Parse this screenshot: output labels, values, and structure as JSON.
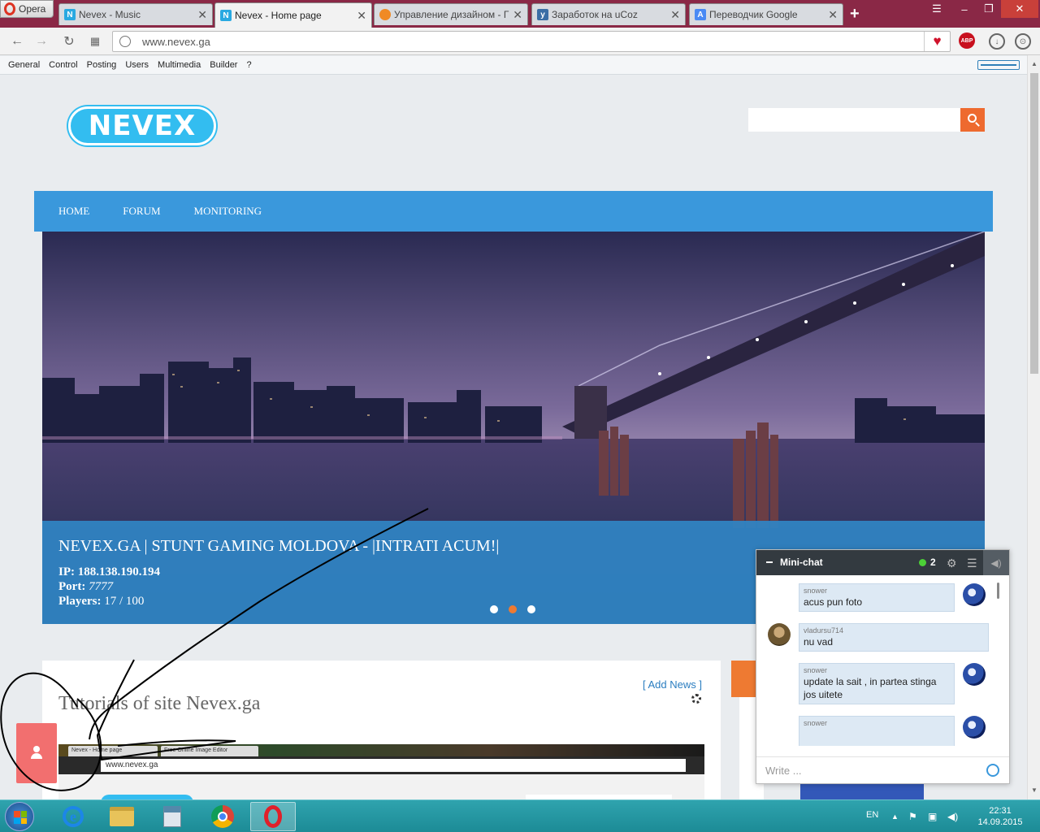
{
  "browser": {
    "menu_label": "Opera",
    "tabs": [
      {
        "title": "Nevex - Music",
        "icon": "nevex-icon",
        "active": false
      },
      {
        "title": "Nevex - Home page",
        "icon": "nevex-icon",
        "active": true
      },
      {
        "title": "Управление дизайном - Г",
        "icon": "ucoz-icon",
        "active": false
      },
      {
        "title": "Заработок на uCoz",
        "icon": "ucoz-y-icon",
        "active": false
      },
      {
        "title": "Переводчик Google",
        "icon": "google-translate-icon",
        "active": false
      }
    ],
    "url": "www.nevex.ga",
    "adblock_label": "ABP"
  },
  "ucoz_panel": {
    "items": [
      "General",
      "Control",
      "Posting",
      "Users",
      "Multimedia",
      "Builder",
      "?"
    ]
  },
  "site": {
    "logo_text": "NEVEX",
    "search_placeholder": "",
    "nav": [
      "HOME",
      "FORUM",
      "MONITORING"
    ],
    "slide": {
      "title": "NEVEX.GA | STUNT GAMING MOLDOVA - |INTRATI ACUM!|",
      "ip_label": "IP:",
      "ip_value": "188.138.190.194",
      "port_label": "Port:",
      "port_value": "7777",
      "players_label": "Players:",
      "players_value": "17 / 100",
      "dots": 3,
      "active_dot": 2
    },
    "add_news": "[ Add News ]",
    "content_title": "Tutorials of site Nevex.ga",
    "embedded_shot": {
      "tab1": "Nevex - Home page",
      "tab2": "Free Online Image Editor",
      "url": "www.nevex.ga"
    }
  },
  "minichat": {
    "title": "Mini-chat",
    "online_count": "2",
    "messages": [
      {
        "user": "snower",
        "text": "acus pun foto",
        "side": "right"
      },
      {
        "user": "vladursu714",
        "text": "nu vad",
        "side": "left"
      },
      {
        "user": "snower",
        "text": "update la sait , in partea stinga jos uitete",
        "side": "right"
      },
      {
        "user": "snower",
        "text": "",
        "side": "right"
      }
    ],
    "input_placeholder": "Write ..."
  },
  "taskbar": {
    "language": "EN",
    "time": "22:31",
    "date": "14.09.2015"
  },
  "colors": {
    "opera_tabbar": "#8a2846",
    "nav_blue": "#3a98dc",
    "accent_orange": "#ee6a2f",
    "logo_cyan": "#33bdf0",
    "user_button": "#f26f6f",
    "chat_header": "#333a40"
  }
}
